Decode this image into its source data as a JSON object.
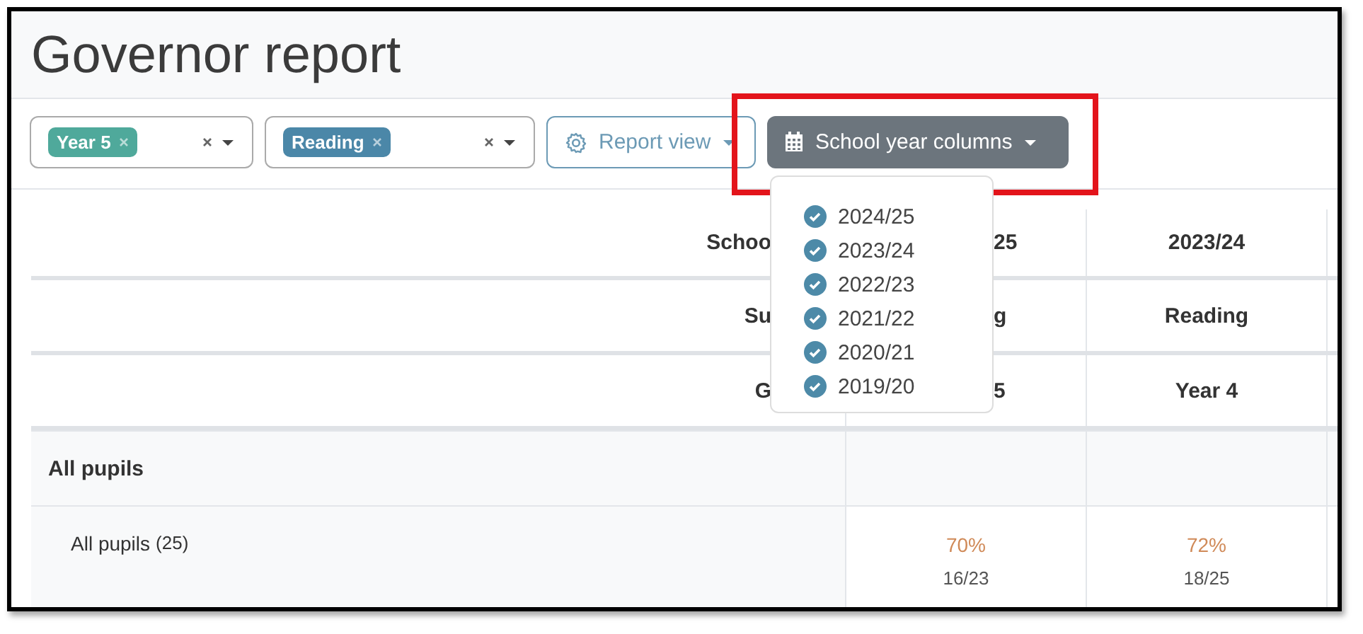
{
  "title": "Governor report",
  "filters": [
    {
      "chip": "Year 5",
      "color": "#4fa99b"
    },
    {
      "chip": "Reading",
      "color": "#4b87a8"
    }
  ],
  "report_view_button": {
    "label": "Report view"
  },
  "school_year_button": {
    "label": "School year columns",
    "highlighted": true
  },
  "school_year_menu": [
    {
      "label": "2024/25",
      "checked": true
    },
    {
      "label": "2023/24",
      "checked": true
    },
    {
      "label": "2022/23",
      "checked": true
    },
    {
      "label": "2021/22",
      "checked": true
    },
    {
      "label": "2020/21",
      "checked": true
    },
    {
      "label": "2019/20",
      "checked": true
    }
  ],
  "table": {
    "header_rows": [
      {
        "label": "Schoo",
        "cells": [
          "25",
          "2023/24"
        ]
      },
      {
        "label": "Su",
        "cells": [
          "g",
          "Reading"
        ]
      },
      {
        "label": "G",
        "cells": [
          "5",
          "Year 4"
        ]
      }
    ],
    "groups": [
      {
        "label": "All pupils",
        "rows": [
          {
            "label": "All pupils",
            "count": "(25)",
            "cells": [
              {
                "percent": "70%",
                "fraction": "16/23"
              },
              {
                "percent": "72%",
                "fraction": "18/25"
              }
            ]
          }
        ]
      }
    ]
  }
}
